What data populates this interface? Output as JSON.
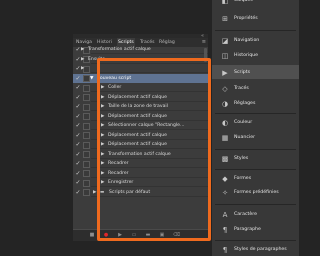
{
  "panel": {
    "tabs": [
      "Naviga",
      "Histori",
      "Scripts",
      "Tracés",
      "Réglag"
    ],
    "active_tab": "Scripts",
    "rows": [
      {
        "type": "action",
        "check": true,
        "label": "Transformation actif calque",
        "expanded": false
      },
      {
        "type": "action",
        "check": true,
        "label": "Ensuite",
        "expanded": false
      },
      {
        "type": "action",
        "check": true,
        "label": "",
        "expanded": false
      },
      {
        "type": "set",
        "check": true,
        "label": "nouveau script",
        "expanded": true,
        "selected": true
      },
      {
        "type": "step",
        "check": true,
        "label": "Coller"
      },
      {
        "type": "step",
        "check": true,
        "label": "Déplacement actif calque"
      },
      {
        "type": "step",
        "check": true,
        "label": "Taille de la zone de travail"
      },
      {
        "type": "step",
        "check": true,
        "label": "Déplacement actif calque"
      },
      {
        "type": "step",
        "check": true,
        "label": "Sélectionner calque \"Rectangle..."
      },
      {
        "type": "step",
        "check": true,
        "label": "Déplacement actif calque"
      },
      {
        "type": "step",
        "check": true,
        "label": "Déplacement actif calque"
      },
      {
        "type": "step",
        "check": true,
        "label": "Transformation actif calque"
      },
      {
        "type": "step",
        "check": true,
        "label": "Recadrer"
      },
      {
        "type": "step",
        "check": true,
        "label": "Recadrer"
      },
      {
        "type": "step",
        "check": true,
        "label": "Enregistrer"
      },
      {
        "type": "folder",
        "check": true,
        "label": "Scripts par défaut"
      }
    ]
  },
  "dock": {
    "items": [
      {
        "label": "Calques",
        "icon": "layers-icon",
        "active": false
      },
      {
        "label": "Propriétés",
        "icon": "properties-icon",
        "active": false
      },
      {
        "label": "Navigation",
        "icon": "navigator-icon",
        "active": false
      },
      {
        "label": "Historique",
        "icon": "history-icon",
        "active": false
      },
      {
        "label": "Scripts",
        "icon": "play-icon",
        "active": true
      },
      {
        "label": "Tracés",
        "icon": "paths-icon",
        "active": false
      },
      {
        "label": "Réglages",
        "icon": "adjustments-icon",
        "active": false
      },
      {
        "label": "Couleur",
        "icon": "color-icon",
        "active": false
      },
      {
        "label": "Nuancier",
        "icon": "swatches-icon",
        "active": false
      },
      {
        "label": "Styles",
        "icon": "styles-icon",
        "active": false
      },
      {
        "label": "Formes",
        "icon": "shapes-icon",
        "active": false
      },
      {
        "label": "Formes prédéfinies",
        "icon": "preset-shapes-icon",
        "active": false
      },
      {
        "label": "Caractère",
        "icon": "character-icon",
        "active": false
      },
      {
        "label": "Paragraphe",
        "icon": "paragraph-icon",
        "active": false
      },
      {
        "label": "Styles de paragraphes",
        "icon": "paragraph-styles-icon",
        "active": false
      }
    ]
  },
  "colors": {
    "highlight": "#ef6a1e",
    "selection": "#5f7392",
    "record": "#e0272a"
  }
}
